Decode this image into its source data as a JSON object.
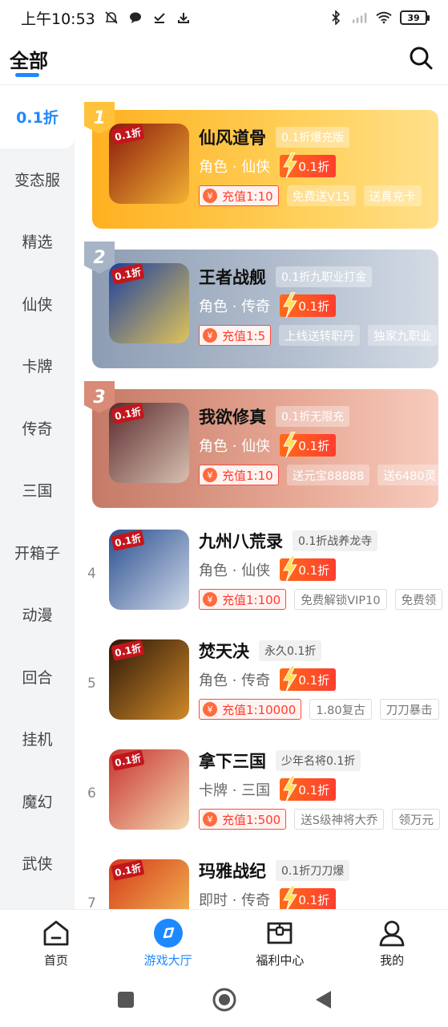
{
  "status_bar": {
    "time": "上午10:53",
    "battery": "39"
  },
  "header": {
    "title": "全部"
  },
  "sidebar": {
    "items": [
      {
        "label": "0.1折"
      },
      {
        "label": "变态服"
      },
      {
        "label": "精选"
      },
      {
        "label": "仙侠"
      },
      {
        "label": "卡牌"
      },
      {
        "label": "传奇"
      },
      {
        "label": "三国"
      },
      {
        "label": "开箱子"
      },
      {
        "label": "动漫"
      },
      {
        "label": "回合"
      },
      {
        "label": "挂机"
      },
      {
        "label": "魔幻"
      },
      {
        "label": "武侠"
      }
    ]
  },
  "games": [
    {
      "rank": "1",
      "title": "仙风道骨",
      "promo": "0.1折爆充版",
      "category": "角色 · 仙侠",
      "discount": "0.1折",
      "recharge": "充值1:10",
      "tags": [
        "免费送V15",
        "送真充卡"
      ],
      "thumb_text": "0.1折",
      "thumb_color_a": "#8a1a0c",
      "thumb_color_b": "#f2b233"
    },
    {
      "rank": "2",
      "title": "王者战舰",
      "promo": "0.1折九职业打金",
      "category": "角色 · 传奇",
      "discount": "0.1折",
      "recharge": "充值1:5",
      "tags": [
        "上线送转职丹",
        "独家九职业"
      ],
      "thumb_text": "0.1折",
      "thumb_color_a": "#1c3f9e",
      "thumb_color_b": "#e0c35a"
    },
    {
      "rank": "3",
      "title": "我欲修真",
      "promo": "0.1折无限充",
      "category": "角色 · 仙侠",
      "discount": "0.1折",
      "recharge": "充值1:10",
      "tags": [
        "送元宝88888",
        "送6480灵"
      ],
      "thumb_text": "0.1折",
      "thumb_color_a": "#5a2a2e",
      "thumb_color_b": "#d8c0b0"
    },
    {
      "rank": "4",
      "title": "九州八荒录",
      "promo": "0.1折战养龙寺",
      "category": "角色 · 仙侠",
      "discount": "0.1折",
      "recharge": "充值1:100",
      "tags": [
        "免费解锁VIP10",
        "免费领"
      ],
      "thumb_text": "0.1折",
      "thumb_color_a": "#2a4f8f",
      "thumb_color_b": "#cfd8e8"
    },
    {
      "rank": "5",
      "title": "焚天决",
      "promo": "永久0.1折",
      "category": "角色 · 传奇",
      "discount": "0.1折",
      "recharge": "充值1:10000",
      "tags": [
        "1.80复古",
        "刀刀暴击"
      ],
      "thumb_text": "0.1折",
      "thumb_color_a": "#2b1608",
      "thumb_color_b": "#d08a2a"
    },
    {
      "rank": "6",
      "title": "拿下三国",
      "promo": "少年名将0.1折",
      "category": "卡牌 · 三国",
      "discount": "0.1折",
      "recharge": "充值1:500",
      "tags": [
        "送S级神将大乔",
        "领万元"
      ],
      "thumb_text": "0.1折",
      "thumb_color_a": "#c8322e",
      "thumb_color_b": "#f4d9b0"
    },
    {
      "rank": "7",
      "title": "玛雅战纪",
      "promo": "0.1折刀刀爆",
      "category": "即时 · 传奇",
      "discount": "0.1折",
      "recharge": "",
      "tags": [],
      "thumb_text": "0.1折",
      "thumb_color_a": "#d33a1a",
      "thumb_color_b": "#f7c65a"
    }
  ],
  "bottom_nav": [
    {
      "label": "首页",
      "icon": "home-icon"
    },
    {
      "label": "游戏大厅",
      "icon": "game-hall-icon"
    },
    {
      "label": "福利中心",
      "icon": "gift-box-icon"
    },
    {
      "label": "我的",
      "icon": "user-icon"
    }
  ],
  "colors": {
    "accent": "#1e88ff",
    "discount": "#ff3d2e",
    "gold": "#ffb020",
    "silver": "#8d9db3",
    "bronze": "#c47a66"
  }
}
